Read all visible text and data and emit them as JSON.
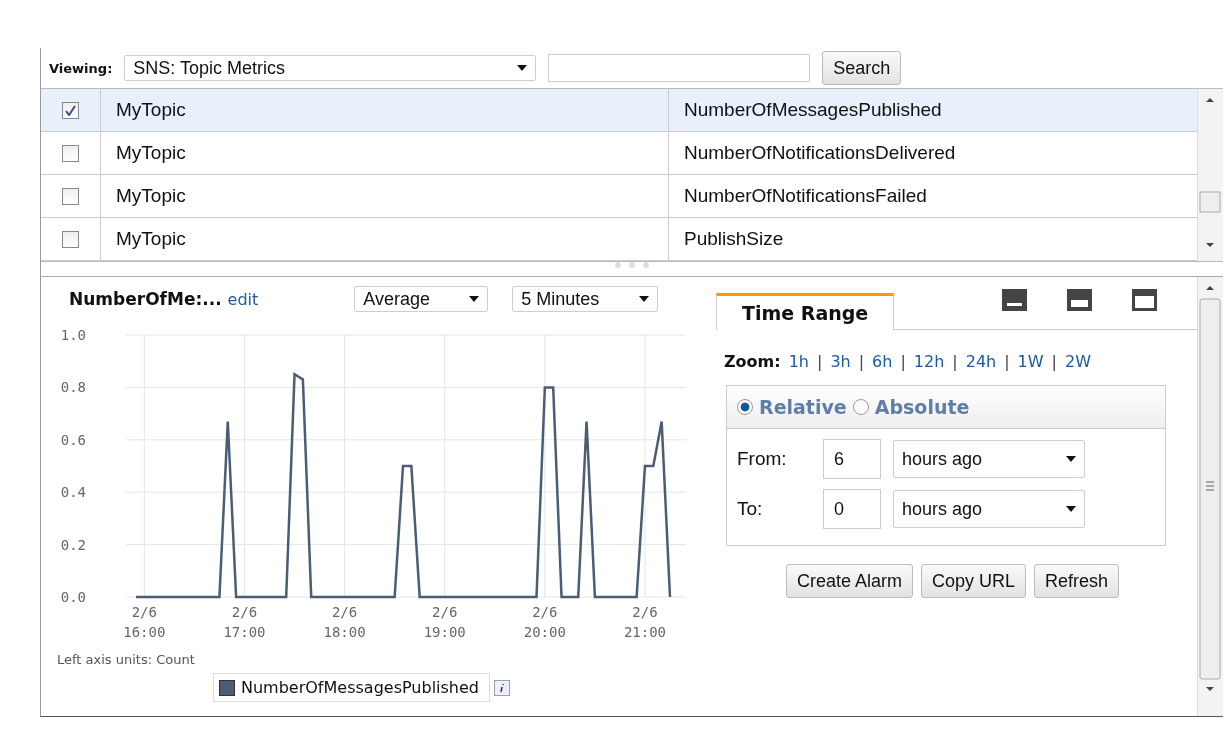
{
  "viewing": {
    "label": "Viewing:",
    "value": "SNS: Topic Metrics"
  },
  "search_button": "Search",
  "rows": [
    {
      "checked": true,
      "selected": true,
      "cells": [
        "MyTopic",
        "NumberOfMessagesPublished"
      ]
    },
    {
      "checked": false,
      "selected": false,
      "cells": [
        "MyTopic",
        "NumberOfNotificationsDelivered"
      ]
    },
    {
      "checked": false,
      "selected": false,
      "cells": [
        "MyTopic",
        "NumberOfNotificationsFailed"
      ]
    },
    {
      "checked": false,
      "selected": false,
      "cells": [
        "MyTopic",
        "PublishSize"
      ]
    }
  ],
  "graph": {
    "title": "NumberOfMe:...",
    "edit": "edit",
    "statistic": "Average",
    "period": "5 Minutes",
    "axis_units": "Left axis units: Count",
    "chart_data": {
      "type": "line",
      "categories": [
        null,
        "2/6 16:00",
        null,
        null,
        null,
        null,
        null,
        null,
        null,
        null,
        null,
        null,
        null,
        "2/6 17:00",
        null,
        null,
        null,
        null,
        null,
        null,
        null,
        null,
        null,
        null,
        null,
        "2/6 18:00",
        null,
        null,
        null,
        null,
        null,
        null,
        null,
        null,
        null,
        null,
        null,
        "2/6 19:00",
        null,
        null,
        null,
        null,
        null,
        null,
        null,
        null,
        null,
        null,
        null,
        "2/6 20:00",
        null,
        null,
        null,
        null,
        null,
        null,
        null,
        null,
        null,
        null,
        null,
        "2/6 21:00",
        null,
        null,
        null
      ],
      "series": [
        {
          "name": "NumberOfMessagesPublished",
          "color": "#4a5d74",
          "values": [
            0,
            0,
            0,
            0,
            0,
            0,
            0,
            0,
            0,
            0,
            0,
            0.67,
            0,
            0,
            0,
            0,
            0,
            0,
            0,
            0.85,
            0.83,
            0,
            0,
            0,
            0,
            0,
            0,
            0,
            0,
            0,
            0,
            0,
            0.5,
            0.5,
            0,
            0,
            0,
            0,
            0,
            0,
            0,
            0,
            0,
            0,
            0,
            0,
            0,
            0,
            0,
            0.8,
            0.8,
            0,
            0,
            0,
            0.67,
            0,
            0,
            0,
            0,
            0,
            0,
            0.5,
            0.5,
            0.67,
            0
          ]
        }
      ],
      "ylim": [
        0,
        1
      ],
      "grid": true,
      "yticks": [
        {
          "value": 0,
          "label": "0.0"
        },
        {
          "value": 0.2,
          "label": "0.2"
        },
        {
          "value": 0.4,
          "label": "0.4"
        },
        {
          "value": 0.6,
          "label": "0.6"
        },
        {
          "value": 0.8,
          "label": "0.8"
        },
        {
          "value": 1,
          "label": "1.0"
        }
      ]
    }
  },
  "time_range": {
    "tab": {
      "label": "Time Range",
      "selected": true
    },
    "zoom_label": "Zoom:",
    "zoom_links": [
      "1h",
      "3h",
      "6h",
      "12h",
      "24h",
      "1W",
      "2W"
    ],
    "zoom_separators": [
      "|",
      "|",
      "|",
      "|",
      "|",
      "|"
    ],
    "modes": [
      {
        "label": "Relative",
        "selected": true
      },
      {
        "label": "Absolute",
        "selected": false
      }
    ],
    "fields": [
      {
        "label": "From:",
        "value": "6",
        "unit": "hours ago"
      },
      {
        "label": "To:",
        "value": "0",
        "unit": "hours ago"
      }
    ],
    "buttons": [
      "Create Alarm",
      "Copy URL",
      "Refresh"
    ]
  }
}
